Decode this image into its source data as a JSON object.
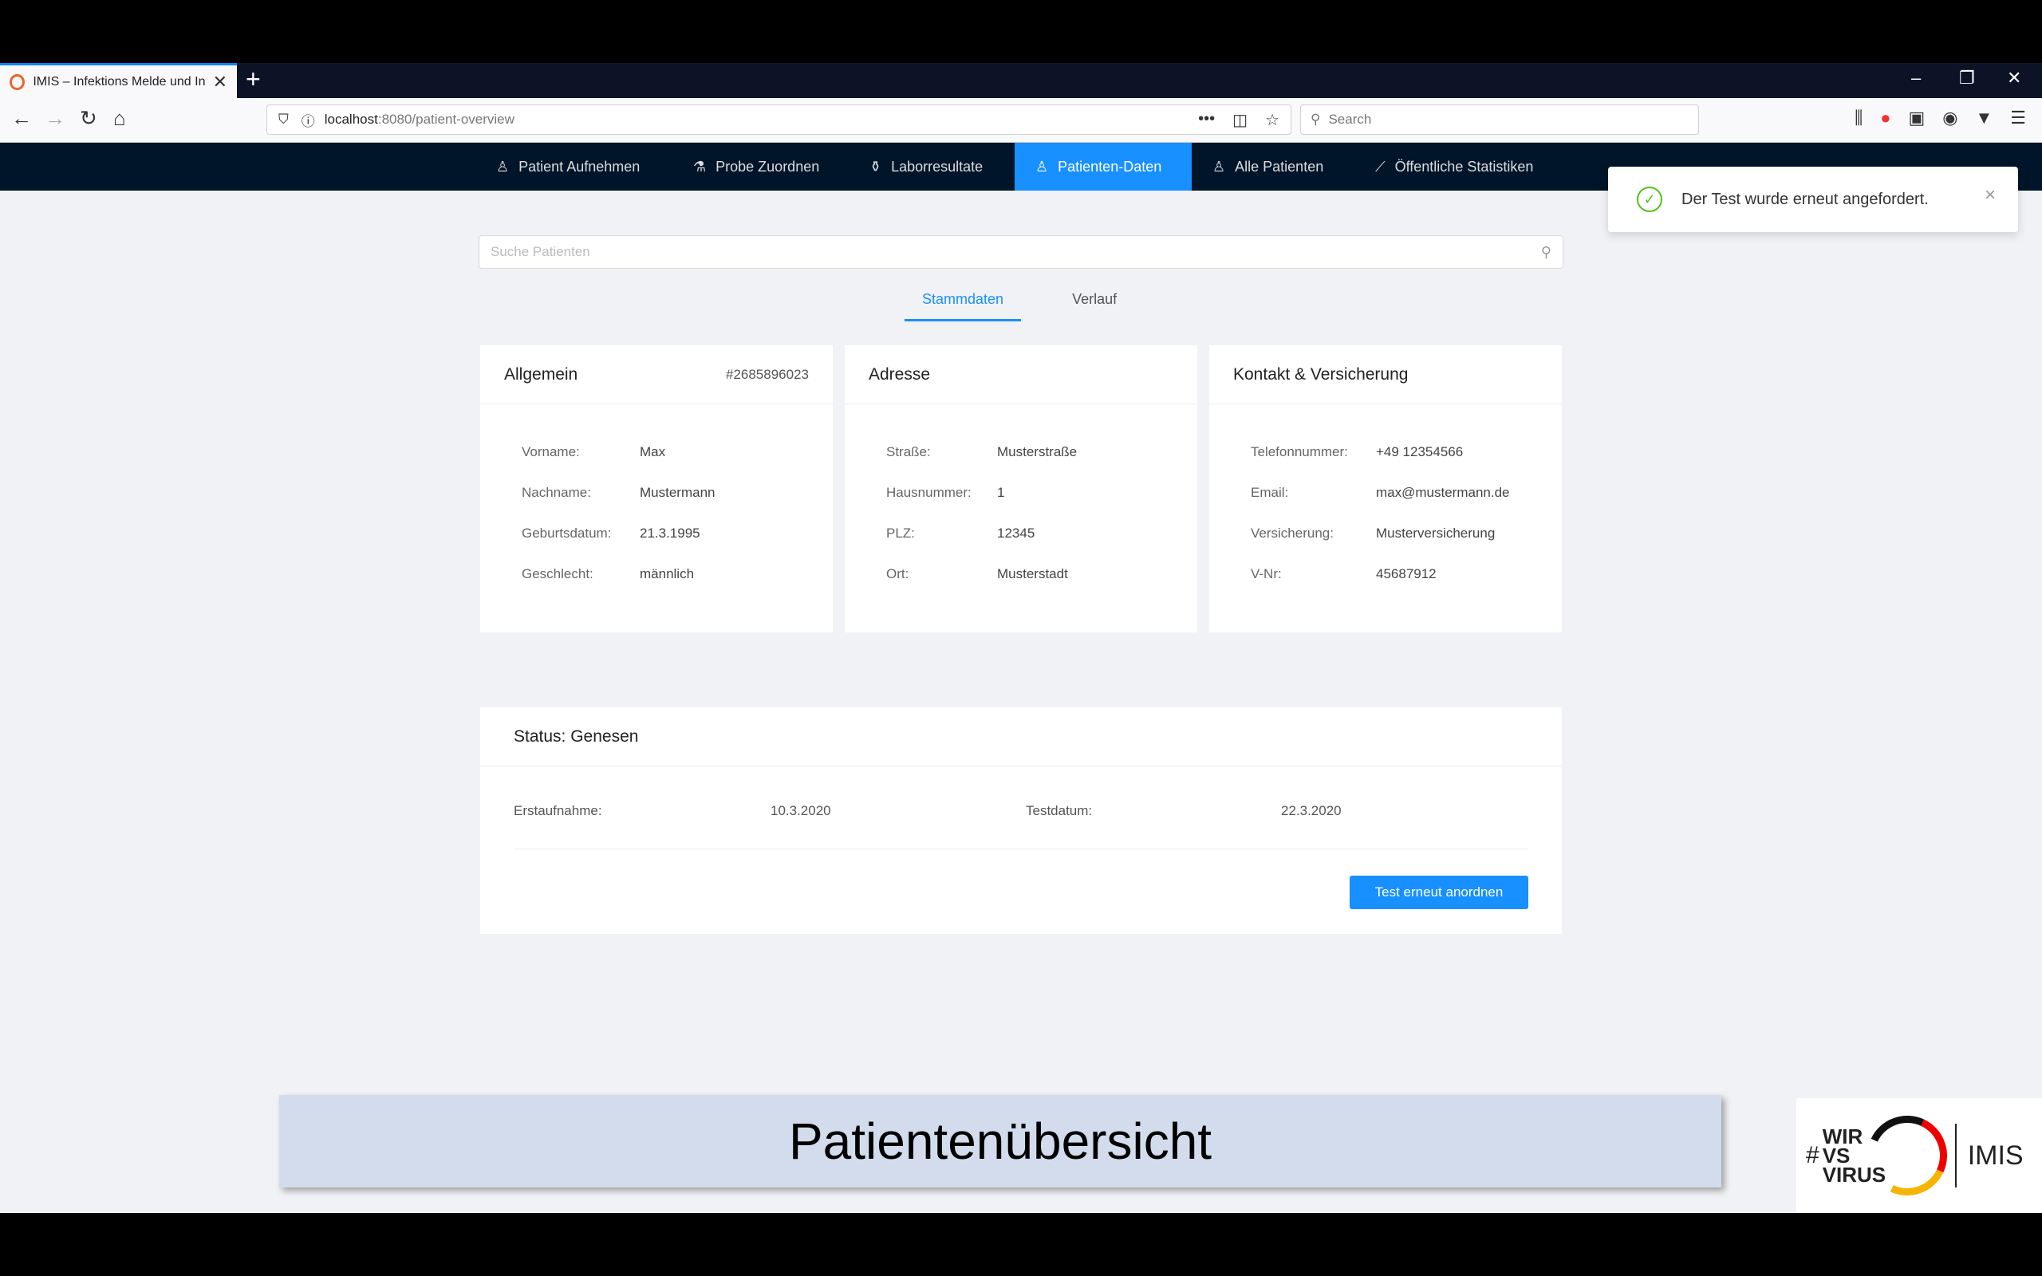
{
  "browser": {
    "tab_title": "IMIS – Infektions Melde und In",
    "tab_close": "✕",
    "new_tab": "+",
    "url_host": "localhost",
    "url_path": ":8080/patient-overview",
    "search_placeholder": "Search"
  },
  "nav": {
    "items": [
      {
        "label": "Patient Aufnehmen"
      },
      {
        "label": "Probe Zuordnen"
      },
      {
        "label": "Laborresultate"
      },
      {
        "label": "Patienten-Daten"
      },
      {
        "label": "Alle Patienten"
      },
      {
        "label": "Öffentliche Statistiken"
      }
    ],
    "active_index": 3
  },
  "notification": {
    "message": "Der Test wurde erneut angefordert.",
    "close": "×"
  },
  "search": {
    "placeholder": "Suche Patienten"
  },
  "tabs": [
    {
      "label": "Stammdaten"
    },
    {
      "label": "Verlauf"
    }
  ],
  "cards": {
    "general": {
      "title": "Allgemein",
      "id": "#2685896023",
      "rows": [
        {
          "label": "Vorname:",
          "value": "Max"
        },
        {
          "label": "Nachname:",
          "value": "Mustermann"
        },
        {
          "label": "Geburtsdatum:",
          "value": "21.3.1995"
        },
        {
          "label": "Geschlecht:",
          "value": "männlich"
        }
      ]
    },
    "address": {
      "title": "Adresse",
      "rows": [
        {
          "label": "Straße:",
          "value": "Musterstraße"
        },
        {
          "label": "Hausnummer:",
          "value": "1"
        },
        {
          "label": "PLZ:",
          "value": "12345"
        },
        {
          "label": "Ort:",
          "value": "Musterstadt"
        }
      ]
    },
    "contact": {
      "title": "Kontakt & Versicherung",
      "rows": [
        {
          "label": "Telefonnummer:",
          "value": "+49 12354566"
        },
        {
          "label": "Email:",
          "value": "max@mustermann.de"
        },
        {
          "label": "Versicherung:",
          "value": "Musterversicherung"
        },
        {
          "label": "V-Nr:",
          "value": "45687912"
        }
      ]
    }
  },
  "status": {
    "title": "Status: Genesen",
    "admission_label": "Erstaufnahme:",
    "admission_value": "10.3.2020",
    "test_label": "Testdatum:",
    "test_value": "22.3.2020",
    "button": "Test erneut anordnen"
  },
  "caption": "Patientenübersicht",
  "logo": {
    "hash": "#",
    "wir": "WIR",
    "vs": "VS",
    "virus": "VIRUS",
    "imis": "IMIS"
  },
  "colors": {
    "nav_bg": "#001529",
    "accent": "#1890ff",
    "success": "#52c41a"
  }
}
